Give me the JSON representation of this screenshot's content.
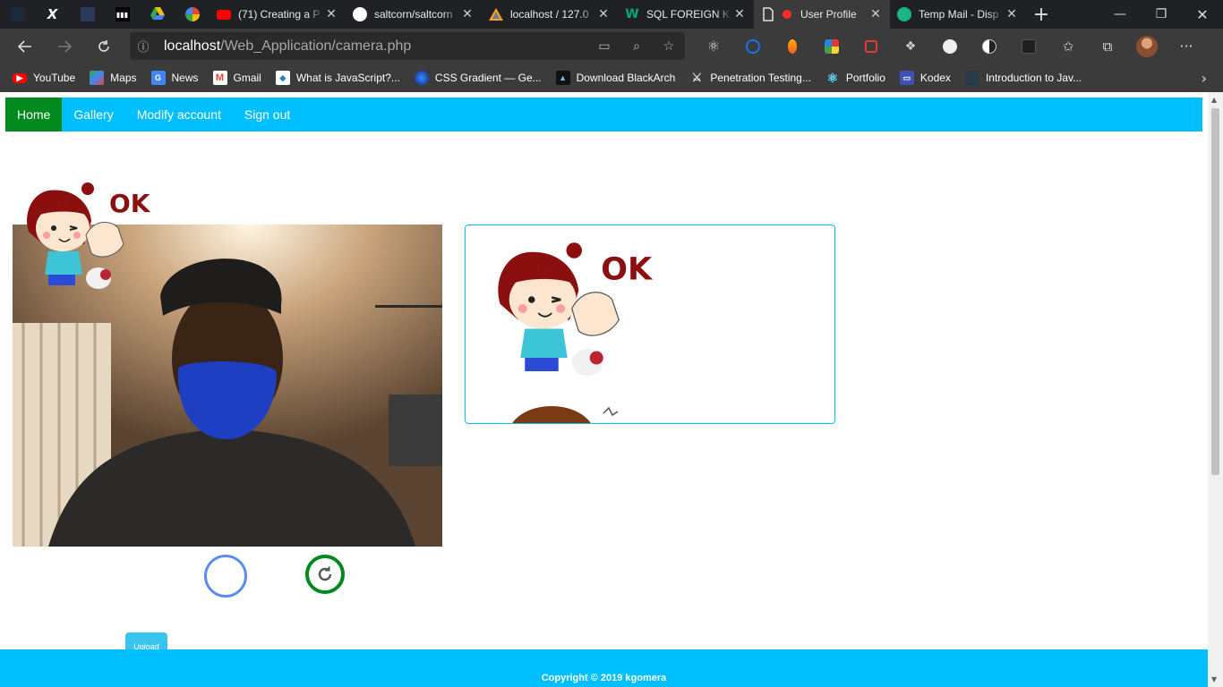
{
  "browser": {
    "pinned_tabs": [
      {
        "icon": "app-icon"
      },
      {
        "icon": "x-icon"
      },
      {
        "icon": "app-icon"
      },
      {
        "icon": "medium-icon"
      },
      {
        "icon": "google-drive-icon"
      },
      {
        "icon": "google-icon"
      }
    ],
    "tabs": [
      {
        "title": "(71) Creating a P",
        "icon": "youtube-icon",
        "color": "#ff0000"
      },
      {
        "title": "saltcorn/saltcorn",
        "icon": "github-icon",
        "color": "#ffffff"
      },
      {
        "title": "localhost / 127.0",
        "icon": "phpmyadmin-icon",
        "color": "#f7a21b"
      },
      {
        "title": "SQL FOREIGN K",
        "icon": "w3schools-icon",
        "color": "#04aa6d"
      },
      {
        "title": "User Profile",
        "icon": "page-icon",
        "color": "#ffffff",
        "active": true,
        "recording": true
      },
      {
        "title": "Temp Mail - Disp",
        "icon": "tempmail-icon",
        "color": "#1bb38b"
      }
    ],
    "address": {
      "host": "localhost",
      "path": "/Web_Application/camera.php"
    },
    "bookmarks": [
      {
        "label": "YouTube",
        "icon": "youtube-icon",
        "color": "#ff0000"
      },
      {
        "label": "Maps",
        "icon": "maps-icon",
        "color": "#34a853"
      },
      {
        "label": "News",
        "icon": "news-icon",
        "color": "#4285f4"
      },
      {
        "label": "Gmail",
        "icon": "gmail-icon",
        "color": "#ea4335"
      },
      {
        "label": "What is JavaScript?...",
        "icon": "js-icon",
        "color": "#2f7fc1"
      },
      {
        "label": "CSS Gradient — Ge...",
        "icon": "css-gradient-icon",
        "color": "#1e5bd6"
      },
      {
        "label": "Download BlackArch",
        "icon": "blackarch-icon",
        "color": "#111111"
      },
      {
        "label": "Penetration Testing...",
        "icon": "pentest-icon",
        "color": "#555555"
      },
      {
        "label": "Portfolio",
        "icon": "react-icon",
        "color": "#61dafb"
      },
      {
        "label": "Kodex",
        "icon": "kodex-icon",
        "color": "#3f51b5"
      },
      {
        "label": "Introduction to Jav...",
        "icon": "course-icon",
        "color": "#2a3a4a"
      }
    ]
  },
  "site": {
    "nav": [
      {
        "label": "Home",
        "active": true
      },
      {
        "label": "Gallery"
      },
      {
        "label": "Modify account"
      },
      {
        "label": "Sign out"
      }
    ],
    "sticker_text": "OK",
    "upload_label": "Upload",
    "footer": "Copyright © 2019 kgomera",
    "accent": "#00bfff",
    "active_nav_color": "#008a1e"
  }
}
